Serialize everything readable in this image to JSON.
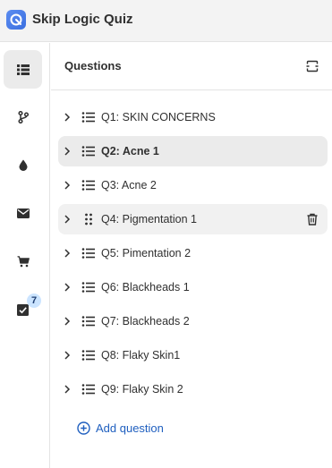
{
  "app": {
    "title": "Skip Logic Quiz",
    "icon": "app-logo-icon",
    "accent_color": "#3b6fe0"
  },
  "rail": {
    "items": [
      {
        "icon": "questions-list-icon",
        "active": true
      },
      {
        "icon": "branch-logic-icon",
        "active": false
      },
      {
        "icon": "drop-icon",
        "active": false
      },
      {
        "icon": "envelope-icon",
        "active": false
      },
      {
        "icon": "cart-icon",
        "active": false
      },
      {
        "icon": "checkbox-icon",
        "active": false,
        "badge": "7"
      }
    ]
  },
  "panel": {
    "title": "Questions",
    "expand_icon": "expand-collapse-icon"
  },
  "questions": [
    {
      "label": "Q1: SKIN CONCERNS",
      "state": "normal"
    },
    {
      "label": "Q2: Acne 1",
      "state": "selected"
    },
    {
      "label": "Q3: Acne 2",
      "state": "normal"
    },
    {
      "label": "Q4: Pigmentation 1",
      "state": "hover"
    },
    {
      "label": "Q5: Pimentation 2",
      "state": "normal"
    },
    {
      "label": "Q6: Blackheads 1",
      "state": "normal"
    },
    {
      "label": "Q7: Blackheads 2",
      "state": "normal"
    },
    {
      "label": "Q8: Flaky Skin1",
      "state": "normal"
    },
    {
      "label": "Q9: Flaky Skin 2",
      "state": "normal"
    }
  ],
  "add_question": {
    "label": "Add question",
    "color": "#1f5fbf"
  }
}
